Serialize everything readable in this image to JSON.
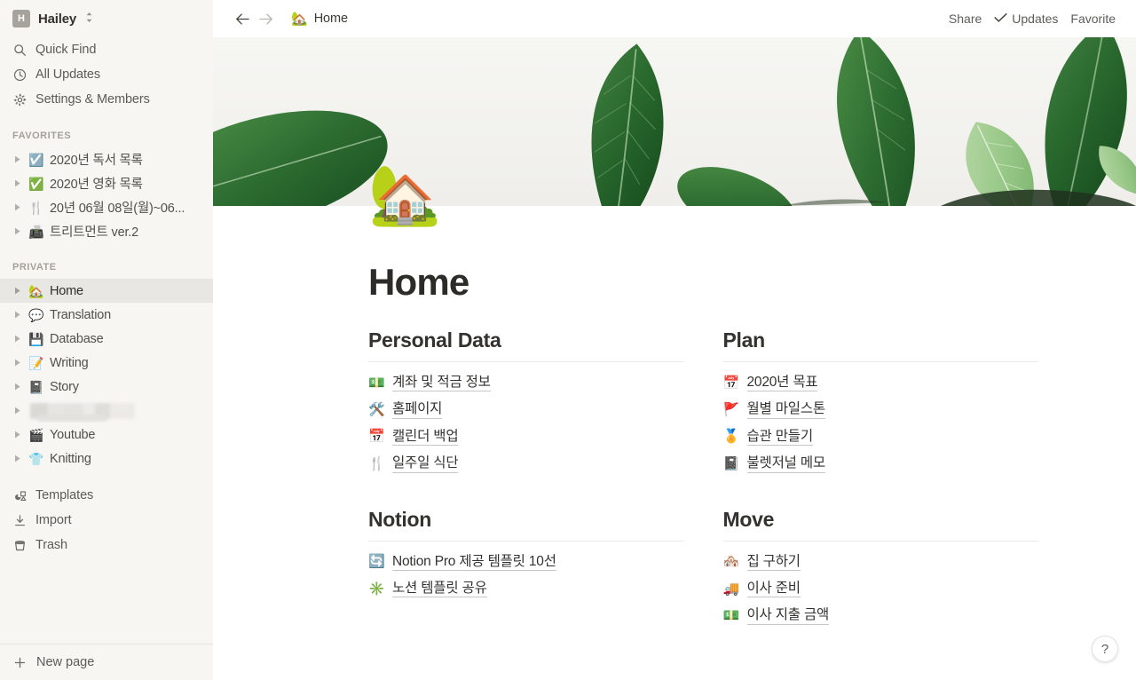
{
  "sidebar": {
    "workspace": {
      "avatar_letter": "H",
      "name": "Hailey",
      "caret_icon": "chevron-updown-icon"
    },
    "nav": [
      {
        "label": "Quick Find",
        "icon": "search-icon"
      },
      {
        "label": "All Updates",
        "icon": "clock-icon"
      },
      {
        "label": "Settings & Members",
        "icon": "gear-icon"
      }
    ],
    "favorites_title": "FAVORITES",
    "favorites": [
      {
        "label": "2020년 독서 목록",
        "emoji": "☑️"
      },
      {
        "label": "2020년 영화 목록",
        "emoji": "✅"
      },
      {
        "label": "20년 06월 08일(월)~06...",
        "emoji": "🍴"
      },
      {
        "label": "트리트먼트 ver.2",
        "emoji": "📠"
      }
    ],
    "private_title": "PRIVATE",
    "private": [
      {
        "label": "Home",
        "emoji": "🏡",
        "active": true
      },
      {
        "label": "Translation",
        "emoji": "💬",
        "active": false
      },
      {
        "label": "Database",
        "emoji": "💾",
        "active": false
      },
      {
        "label": "Writing",
        "emoji": "📝",
        "active": false
      },
      {
        "label": "Story",
        "emoji": "📓",
        "active": false
      },
      {
        "label": "",
        "emoji": "",
        "active": false,
        "redacted": true
      },
      {
        "label": "Youtube",
        "emoji": "🎬",
        "active": false
      },
      {
        "label": "Knitting",
        "emoji": "👕",
        "active": false
      }
    ],
    "utility": [
      {
        "label": "Templates",
        "icon": "templates-icon"
      },
      {
        "label": "Import",
        "icon": "import-icon"
      },
      {
        "label": "Trash",
        "icon": "trash-icon"
      }
    ],
    "new_page": {
      "label": "New page",
      "icon": "plus-icon"
    }
  },
  "topbar": {
    "back_icon": "arrow-left-icon",
    "forward_icon": "arrow-right-icon",
    "breadcrumb": {
      "emoji": "🏡",
      "label": "Home"
    },
    "actions": [
      {
        "label": "Share",
        "icon": ""
      },
      {
        "label": "Updates",
        "icon": "check-icon"
      },
      {
        "label": "Favorite",
        "icon": ""
      }
    ]
  },
  "page": {
    "cover_alt": "green zz plant leaves on white background",
    "emoji": "🏡",
    "title": "Home",
    "columns": [
      {
        "heading": "Personal Data",
        "links": [
          {
            "emoji": "💵",
            "label": "계좌 및 적금 정보"
          },
          {
            "emoji": "🛠️",
            "label": "홈페이지"
          },
          {
            "emoji": "📅",
            "label": "캘린더 백업"
          },
          {
            "emoji": "🍴",
            "label": "일주일 식단"
          }
        ]
      },
      {
        "heading": "Plan",
        "links": [
          {
            "emoji": "📅",
            "label": "2020년 목표"
          },
          {
            "emoji": "🚩",
            "label": "월별 마일스톤"
          },
          {
            "emoji": "🏅",
            "label": "습관 만들기"
          },
          {
            "emoji": "📓",
            "label": "불렛저널 메모"
          }
        ]
      },
      {
        "heading": "Notion",
        "links": [
          {
            "emoji": "🔄",
            "label": "Notion Pro 제공 템플릿 10선"
          },
          {
            "emoji": "✳️",
            "label": "노션 템플릿 공유"
          }
        ]
      },
      {
        "heading": "Move",
        "links": [
          {
            "emoji": "🏘️",
            "label": "집 구하기"
          },
          {
            "emoji": "🚚",
            "label": "이사 준비"
          },
          {
            "emoji": "💵",
            "label": "이사 지출 금액"
          }
        ]
      }
    ]
  },
  "help_button": {
    "label": "?",
    "icon": "question-mark-icon"
  },
  "colors": {
    "sidebar_bg": "#f7f6f3",
    "sidebar_active": "#e8e7e3",
    "text_primary": "#2c2b28",
    "text_secondary": "#5c5b57",
    "cover_bg": "#f4f4f1",
    "leaf_green": "#2f6b33"
  }
}
